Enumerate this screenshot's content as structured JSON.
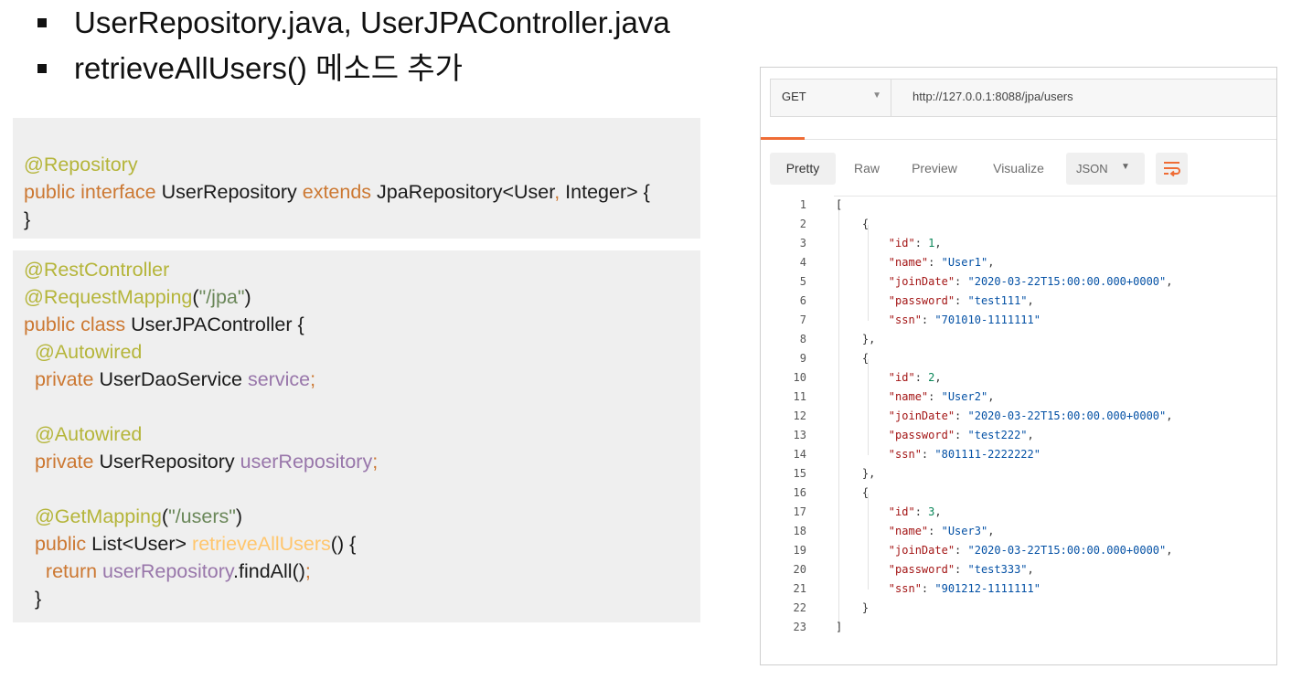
{
  "bullets": [
    "UserRepository.java, UserJPAController.java",
    "retrieveAllUsers() 메소드 추가"
  ],
  "code_block_1": [
    [
      [
        "ann",
        "@Repository"
      ]
    ],
    [
      [
        "kw",
        "public interface "
      ],
      [
        "pln",
        "UserRepository "
      ],
      [
        "kw",
        "extends "
      ],
      [
        "pln",
        "JpaRepository<User"
      ],
      [
        "kw",
        ", "
      ],
      [
        "pln",
        "Integer> {"
      ]
    ],
    [
      [
        "pln",
        "}"
      ]
    ]
  ],
  "code_block_2": [
    [
      [
        "ann",
        "@RestController"
      ]
    ],
    [
      [
        "ann",
        "@RequestMapping"
      ],
      [
        "pln",
        "("
      ],
      [
        "str",
        "\"/jpa\""
      ],
      [
        "pln",
        ")"
      ]
    ],
    [
      [
        "kw",
        "public class "
      ],
      [
        "pln",
        "UserJPAController {"
      ]
    ],
    [
      [
        "pln",
        "  "
      ],
      [
        "ann",
        "@Autowired"
      ]
    ],
    [
      [
        "pln",
        "  "
      ],
      [
        "kw",
        "private "
      ],
      [
        "pln",
        "UserDaoService "
      ],
      [
        "fld",
        "service"
      ],
      [
        "kw",
        ";"
      ]
    ],
    [],
    [
      [
        "pln",
        "  "
      ],
      [
        "ann",
        "@Autowired"
      ]
    ],
    [
      [
        "pln",
        "  "
      ],
      [
        "kw",
        "private "
      ],
      [
        "pln",
        "UserRepository "
      ],
      [
        "fld",
        "userRepository"
      ],
      [
        "kw",
        ";"
      ]
    ],
    [],
    [
      [
        "pln",
        "  "
      ],
      [
        "ann",
        "@GetMapping"
      ],
      [
        "pln",
        "("
      ],
      [
        "str",
        "\"/users\""
      ],
      [
        "pln",
        ")"
      ]
    ],
    [
      [
        "pln",
        "  "
      ],
      [
        "kw",
        "public "
      ],
      [
        "pln",
        "List<User> "
      ],
      [
        "mth",
        "retrieveAllUsers"
      ],
      [
        "pln",
        "() {"
      ]
    ],
    [
      [
        "pln",
        "    "
      ],
      [
        "kw",
        "return "
      ],
      [
        "fld",
        "userRepository"
      ],
      [
        "pln",
        ".findAll()"
      ],
      [
        "kw",
        ";"
      ]
    ],
    [
      [
        "pln",
        "  }"
      ]
    ]
  ],
  "postman": {
    "method": "GET",
    "url": "http://127.0.0.1:8088/jpa/users",
    "tabs": [
      "Pretty",
      "Raw",
      "Preview",
      "Visualize"
    ],
    "active_tab": "Pretty",
    "format": "JSON",
    "accent_color": "#ef6c35",
    "line_numbers": [
      "1",
      "2",
      "3",
      "4",
      "5",
      "6",
      "7",
      "8",
      "9",
      "10",
      "11",
      "12",
      "13",
      "14",
      "15",
      "16",
      "17",
      "18",
      "19",
      "20",
      "21",
      "22",
      "23"
    ],
    "response_lines": [
      [
        [
          "p",
          "["
        ]
      ],
      [
        [
          "p",
          "    {"
        ]
      ],
      [
        [
          "p",
          "        "
        ],
        [
          "k",
          "\"id\""
        ],
        [
          "p",
          ": "
        ],
        [
          "n",
          "1"
        ],
        [
          "p",
          ","
        ]
      ],
      [
        [
          "p",
          "        "
        ],
        [
          "k",
          "\"name\""
        ],
        [
          "p",
          ": "
        ],
        [
          "s",
          "\"User1\""
        ],
        [
          "p",
          ","
        ]
      ],
      [
        [
          "p",
          "        "
        ],
        [
          "k",
          "\"joinDate\""
        ],
        [
          "p",
          ": "
        ],
        [
          "s",
          "\"2020-03-22T15:00:00.000+0000\""
        ],
        [
          "p",
          ","
        ]
      ],
      [
        [
          "p",
          "        "
        ],
        [
          "k",
          "\"password\""
        ],
        [
          "p",
          ": "
        ],
        [
          "s",
          "\"test111\""
        ],
        [
          "p",
          ","
        ]
      ],
      [
        [
          "p",
          "        "
        ],
        [
          "k",
          "\"ssn\""
        ],
        [
          "p",
          ": "
        ],
        [
          "s",
          "\"701010-1111111\""
        ]
      ],
      [
        [
          "p",
          "    },"
        ]
      ],
      [
        [
          "p",
          "    {"
        ]
      ],
      [
        [
          "p",
          "        "
        ],
        [
          "k",
          "\"id\""
        ],
        [
          "p",
          ": "
        ],
        [
          "n",
          "2"
        ],
        [
          "p",
          ","
        ]
      ],
      [
        [
          "p",
          "        "
        ],
        [
          "k",
          "\"name\""
        ],
        [
          "p",
          ": "
        ],
        [
          "s",
          "\"User2\""
        ],
        [
          "p",
          ","
        ]
      ],
      [
        [
          "p",
          "        "
        ],
        [
          "k",
          "\"joinDate\""
        ],
        [
          "p",
          ": "
        ],
        [
          "s",
          "\"2020-03-22T15:00:00.000+0000\""
        ],
        [
          "p",
          ","
        ]
      ],
      [
        [
          "p",
          "        "
        ],
        [
          "k",
          "\"password\""
        ],
        [
          "p",
          ": "
        ],
        [
          "s",
          "\"test222\""
        ],
        [
          "p",
          ","
        ]
      ],
      [
        [
          "p",
          "        "
        ],
        [
          "k",
          "\"ssn\""
        ],
        [
          "p",
          ": "
        ],
        [
          "s",
          "\"801111-2222222\""
        ]
      ],
      [
        [
          "p",
          "    },"
        ]
      ],
      [
        [
          "p",
          "    {"
        ]
      ],
      [
        [
          "p",
          "        "
        ],
        [
          "k",
          "\"id\""
        ],
        [
          "p",
          ": "
        ],
        [
          "n",
          "3"
        ],
        [
          "p",
          ","
        ]
      ],
      [
        [
          "p",
          "        "
        ],
        [
          "k",
          "\"name\""
        ],
        [
          "p",
          ": "
        ],
        [
          "s",
          "\"User3\""
        ],
        [
          "p",
          ","
        ]
      ],
      [
        [
          "p",
          "        "
        ],
        [
          "k",
          "\"joinDate\""
        ],
        [
          "p",
          ": "
        ],
        [
          "s",
          "\"2020-03-22T15:00:00.000+0000\""
        ],
        [
          "p",
          ","
        ]
      ],
      [
        [
          "p",
          "        "
        ],
        [
          "k",
          "\"password\""
        ],
        [
          "p",
          ": "
        ],
        [
          "s",
          "\"test333\""
        ],
        [
          "p",
          ","
        ]
      ],
      [
        [
          "p",
          "        "
        ],
        [
          "k",
          "\"ssn\""
        ],
        [
          "p",
          ": "
        ],
        [
          "s",
          "\"901212-1111111\""
        ]
      ],
      [
        [
          "p",
          "    }"
        ]
      ],
      [
        [
          "p",
          "]"
        ]
      ]
    ]
  }
}
